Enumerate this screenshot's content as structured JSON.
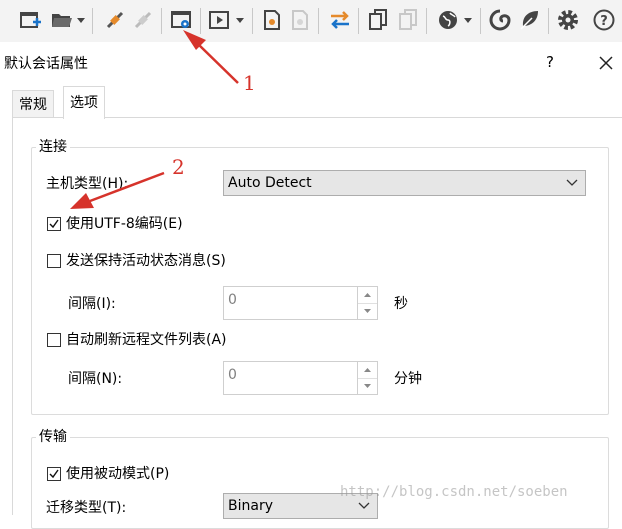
{
  "toolbar": {
    "buttons": [
      {
        "name": "new-connection-icon"
      },
      {
        "name": "open-folder-icon"
      },
      {
        "name": "connect-icon"
      },
      {
        "name": "disconnect-icon"
      },
      {
        "name": "default-properties-icon"
      },
      {
        "name": "play-icon"
      },
      {
        "name": "copy-file-icon"
      },
      {
        "name": "paste-file-icon"
      },
      {
        "name": "transfer-icon"
      },
      {
        "name": "copy-icon"
      },
      {
        "name": "paste-icon"
      },
      {
        "name": "globe-icon"
      },
      {
        "name": "shell-icon"
      },
      {
        "name": "leaf-icon"
      },
      {
        "name": "gear-icon"
      },
      {
        "name": "help-icon"
      }
    ]
  },
  "dialog": {
    "title": "默认会话属性",
    "help_glyph": "?"
  },
  "tabs": [
    {
      "label": "常规",
      "active": false
    },
    {
      "label": "选项",
      "active": true
    }
  ],
  "connection": {
    "title": "连接",
    "host_type_label": "主机类型(H):",
    "host_type_value": "Auto Detect",
    "utf8_label": "使用UTF-8编码(E)",
    "utf8_checked": true,
    "keepalive_label": "发送保持活动状态消息(S)",
    "keepalive_checked": false,
    "keepalive_interval_label": "间隔(I):",
    "keepalive_interval_value": "0",
    "keepalive_unit": "秒",
    "refresh_label": "自动刷新远程文件列表(A)",
    "refresh_checked": false,
    "refresh_interval_label": "间隔(N):",
    "refresh_interval_value": "0",
    "refresh_unit": "分钟"
  },
  "transfer": {
    "title": "传输",
    "passive_label": "使用被动模式(P)",
    "passive_checked": true,
    "mode_label": "迁移类型(T):",
    "mode_value": "Binary"
  },
  "annotations": {
    "one": "1",
    "two": "2",
    "color": "#d6332b"
  },
  "watermark": "http://blog.csdn.net/soeben"
}
